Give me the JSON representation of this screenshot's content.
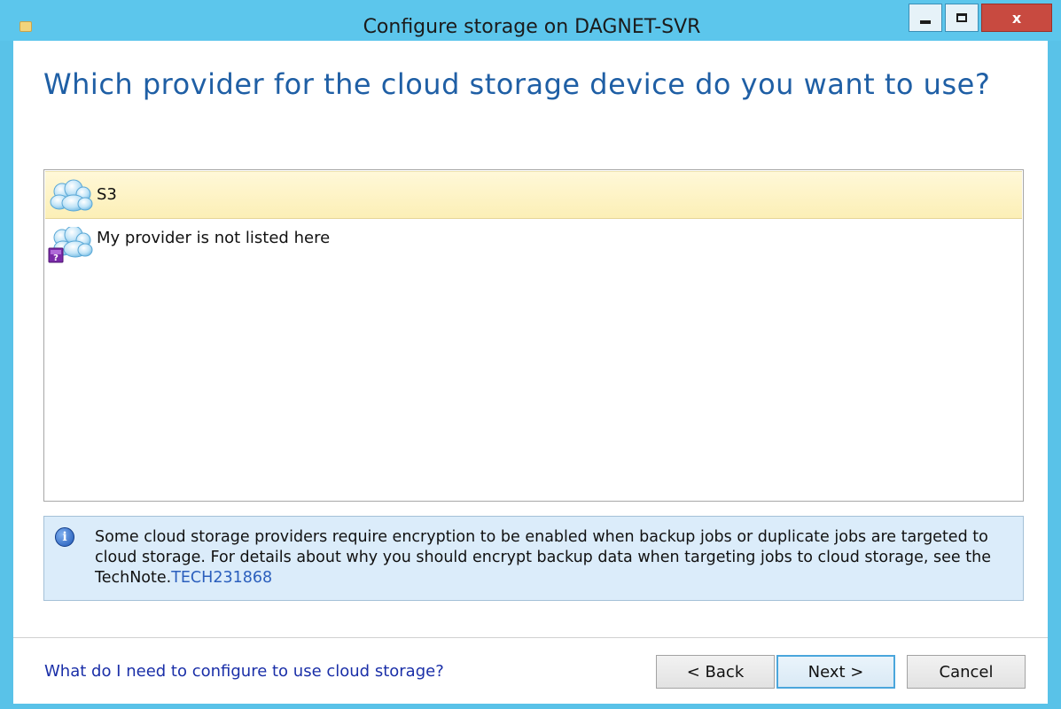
{
  "window": {
    "title": "Configure storage on DAGNET-SVR",
    "minimize_icon": "minimize-icon",
    "maximize_icon": "maximize-icon",
    "close_glyph": "x"
  },
  "wizard": {
    "question": "Which provider for the cloud storage device do you want to use?"
  },
  "providers": [
    {
      "label": "S3",
      "icon": "cloud-icon",
      "selected": true
    },
    {
      "label": "My provider is not listed here",
      "icon": "cloud-unknown-icon",
      "selected": false
    }
  ],
  "info": {
    "icon": "info-icon",
    "text": "Some cloud storage providers require encryption to be enabled when backup jobs or duplicate jobs are targeted to cloud storage. For details about why you should encrypt backup data when targeting jobs to cloud storage, see the TechNote.",
    "link_text": "TECH231868"
  },
  "footer": {
    "help_link": "What do I need to configure to use cloud storage?",
    "back_label": "< Back",
    "next_label": "Next >",
    "cancel_label": "Cancel"
  },
  "colors": {
    "titlebar": "#5cc6ec",
    "heading": "#1f5fa5",
    "selection": "#fcefb6",
    "info_background": "#dbecfa",
    "link": "#1a2fa8"
  }
}
